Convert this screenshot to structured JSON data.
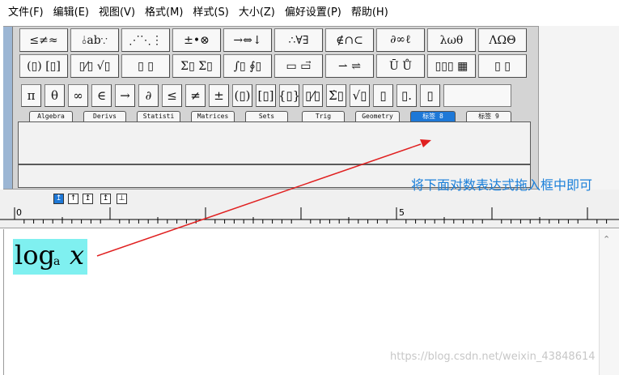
{
  "menu": {
    "items": [
      "文件(F)",
      "编辑(E)",
      "视图(V)",
      "格式(M)",
      "样式(S)",
      "大小(Z)",
      "偏好设置(P)",
      "帮助(H)"
    ]
  },
  "symbol_row1": [
    "≤≠≈",
    "⫰ab∵",
    "⋰⋱⋮",
    "±•⊗",
    "→⇔↓",
    "∴∀∃",
    "∉∩⊂",
    "∂∞ℓ",
    "λωθ",
    "ΛΩΘ"
  ],
  "symbol_row2": [
    "(▯) [▯]",
    "▯⁄▯ √▯",
    "▯⁣ ▯",
    "Σ▯ Σ▯",
    "∫▯ ∮▯",
    "▭ ▭⃗",
    "⇀ ⇌",
    "Ū Ů",
    "▯▯▯ ▦",
    "▯ ▯"
  ],
  "template_row": [
    "π",
    "θ",
    "∞",
    "∈",
    "→",
    "∂",
    "≤",
    "≠",
    "±",
    "(▯)",
    "[▯]",
    "{▯}",
    "▯⁄▯",
    "Σ̇▯",
    "√▯",
    "▯⁣",
    "▯.",
    "▯⁣"
  ],
  "tabs": [
    "Algebra",
    "Derivs",
    "Statisti",
    "Matrices",
    "Sets",
    "Trig",
    "Geometry",
    "标签 8",
    "标签 9"
  ],
  "active_tab": "标签 8",
  "nudge_buttons": [
    "↥",
    "↑",
    "↥",
    "↥"
  ],
  "ruler": {
    "marks": [
      "0",
      "5"
    ]
  },
  "formula": {
    "log": "log",
    "sub": "a",
    "var": "x"
  },
  "annotation": "将下面对数表达式拖入框中即可",
  "watermark": "https://blog.csdn.net/weixin_43848614",
  "colors": {
    "accent": "#1e78d7",
    "highlight": "#7ff0f0",
    "arrow": "#e02020",
    "annotation": "#1a7fd9"
  }
}
